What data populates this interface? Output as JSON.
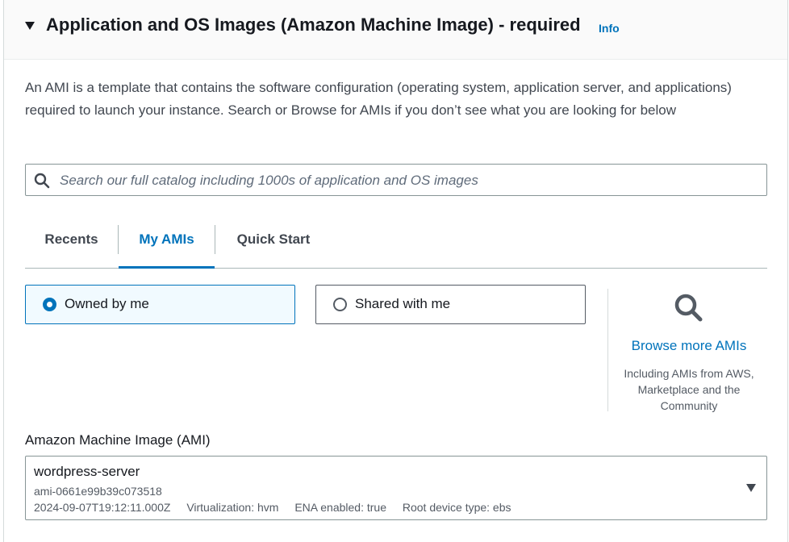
{
  "section": {
    "title": "Application and OS Images (Amazon Machine Image) - required",
    "info_label": "Info",
    "description": "An AMI is a template that contains the software configuration (operating system, application server, and applications) required to launch your instance. Search or Browse for AMIs if you don’t see what you are looking for below"
  },
  "search": {
    "placeholder": "Search our full catalog including 1000s of application and OS images",
    "value": "",
    "icon": "search-icon"
  },
  "tabs": [
    {
      "label": "Recents",
      "active": false
    },
    {
      "label": "My AMIs",
      "active": true
    },
    {
      "label": "Quick Start",
      "active": false
    }
  ],
  "ownership": {
    "options": [
      {
        "label": "Owned by me",
        "selected": true
      },
      {
        "label": "Shared with me",
        "selected": false
      }
    ]
  },
  "browse": {
    "link_label": "Browse more AMIs",
    "sub_text": "Including AMIs from AWS, Marketplace and the Community",
    "icon": "search-icon"
  },
  "ami": {
    "field_label": "Amazon Machine Image (AMI)",
    "name": "wordpress-server",
    "id": "ami-0661e99b39c073518",
    "created": "2024-09-07T19:12:11.000Z",
    "virtualization": "Virtualization: hvm",
    "ena": "ENA enabled: true",
    "root_device": "Root device type: ebs"
  },
  "colors": {
    "accent": "#0073bb",
    "text": "#16191f",
    "secondary_text": "#545b64",
    "selected_tile_bg": "#f1faff",
    "header_bg": "#fafafa"
  }
}
